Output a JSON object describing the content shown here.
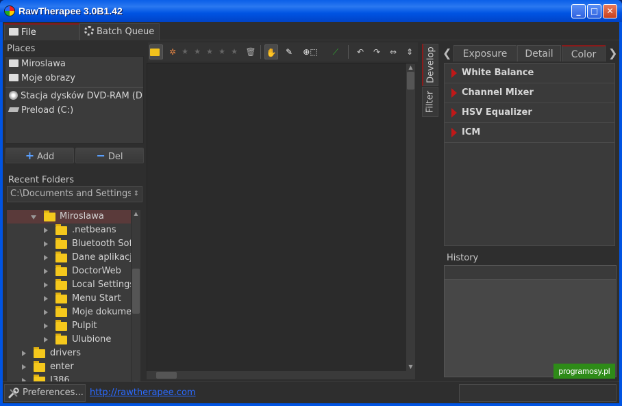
{
  "window": {
    "title": "RawTherapee 3.0B1.42"
  },
  "top_tabs": [
    {
      "label": "File Browser"
    },
    {
      "label": "Batch Queue"
    }
  ],
  "places": {
    "title": "Places",
    "items": [
      {
        "label": "Miroslawa",
        "icon": "folder-icon"
      },
      {
        "label": "Moje obrazy",
        "icon": "folder-icon"
      },
      {
        "label": "Stacja dysków DVD-RAM (D:",
        "icon": "dvd-drive-icon"
      },
      {
        "label": "Preload (C:)",
        "icon": "hard-drive-icon"
      }
    ],
    "add_label": "Add",
    "del_label": "Del"
  },
  "recent": {
    "title": "Recent Folders",
    "value": "C:\\Documents and Settings"
  },
  "tree": [
    {
      "label": "Miroslawa",
      "level": 2,
      "expanded": true,
      "selected": true
    },
    {
      "label": ".netbeans",
      "level": 3
    },
    {
      "label": "Bluetooth Sof",
      "level": 3
    },
    {
      "label": "Dane aplikacj",
      "level": 3
    },
    {
      "label": "DoctorWeb",
      "level": 3
    },
    {
      "label": "Local Settings",
      "level": 3
    },
    {
      "label": "Menu Start",
      "level": 3
    },
    {
      "label": "Moje dokume",
      "level": 3
    },
    {
      "label": "Pulpit",
      "level": 3
    },
    {
      "label": "Ulubione",
      "level": 3
    },
    {
      "label": "drivers",
      "level": 1
    },
    {
      "label": "enter",
      "level": 1
    },
    {
      "label": "I386",
      "level": 1
    }
  ],
  "side_tabs": [
    {
      "label": "Develop"
    },
    {
      "label": "Filter"
    }
  ],
  "right_tabs": [
    {
      "label": "Exposure"
    },
    {
      "label": "Detail"
    },
    {
      "label": "Color"
    }
  ],
  "tools": [
    {
      "label": "White Balance"
    },
    {
      "label": "Channel Mixer"
    },
    {
      "label": "HSV Equalizer"
    },
    {
      "label": "ICM"
    }
  ],
  "history": {
    "title": "History"
  },
  "statusbar": {
    "preferences_label": "Preferences...",
    "link": "http://rawtherapee.com",
    "badge": "programosy.pl"
  },
  "colors": {
    "accent": "#8a1a1a",
    "tool_marker": "#c01818",
    "link": "#2a6aff"
  }
}
